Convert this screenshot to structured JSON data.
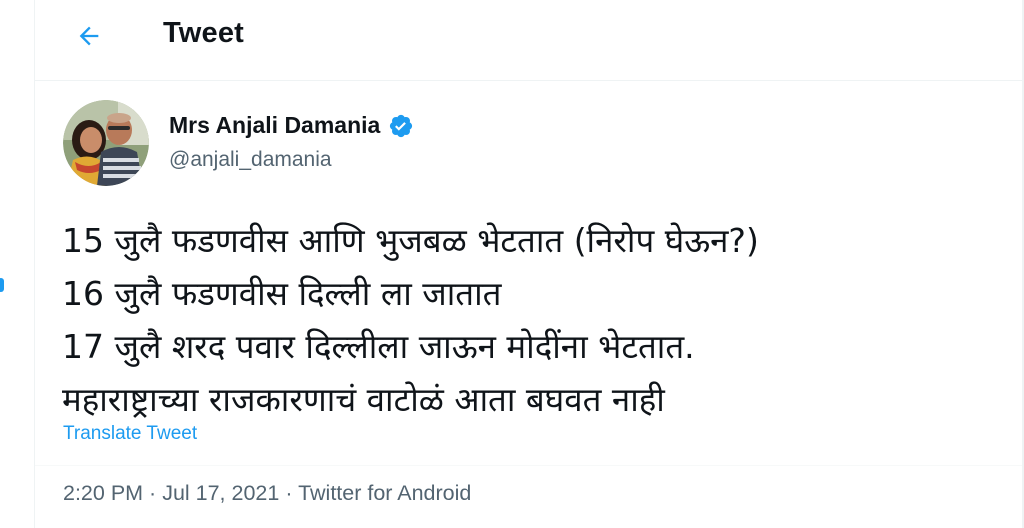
{
  "colors": {
    "accent": "#1d9bf0",
    "text_primary": "#0f1419",
    "text_secondary": "#536471",
    "border": "#eff3f4"
  },
  "header": {
    "back_icon": "arrow-left-icon",
    "title": "Tweet"
  },
  "author": {
    "avatar_icon": "profile-photo",
    "name": "Mrs Anjali Damania",
    "verified_icon": "verified-badge-icon",
    "handle": "@anjali_damania"
  },
  "tweet": {
    "lines": [
      "15 जुलै फडणवीस आणि भुजबळ भेटतात (निरोप घेऊन?)",
      "16 जुलै फडणवीस दिल्ली ला जातात",
      "17 जुलै शरद पवार दिल्लीला जाऊन मोदींना भेटतात.",
      "महाराष्ट्राच्या राजकारणाचं वाटोळं आता बघवत नाही"
    ],
    "translate_label": "Translate Tweet"
  },
  "meta": {
    "time": "2:20 PM",
    "separator": " · ",
    "date": "Jul 17, 2021",
    "source": "Twitter for Android"
  }
}
